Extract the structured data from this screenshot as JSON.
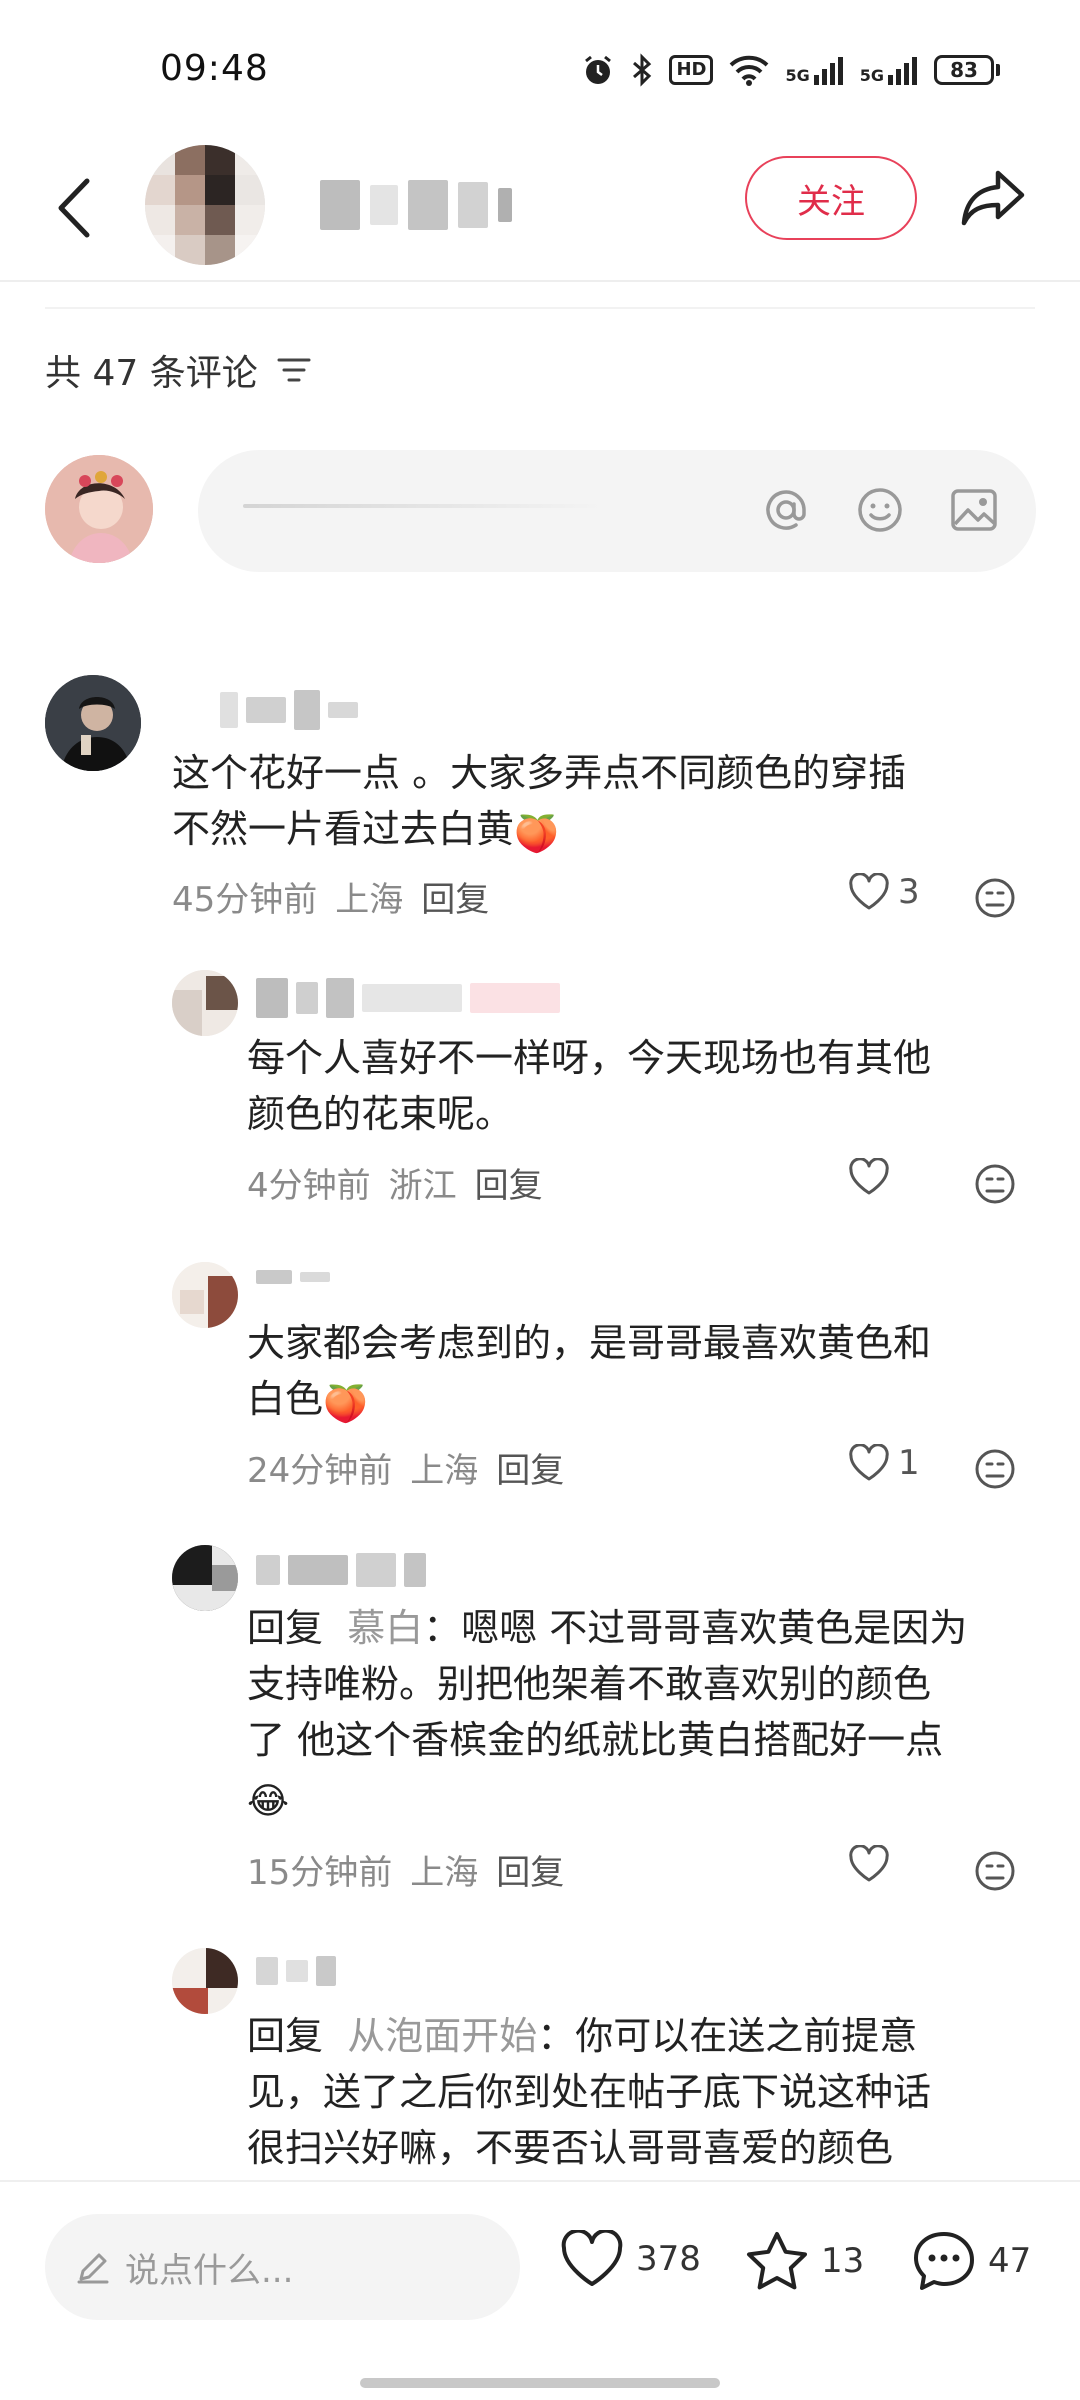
{
  "status_bar": {
    "time": "09:48",
    "hd_label": "HD",
    "net1_label": "5G",
    "net2_label": "5G",
    "battery": "83"
  },
  "header": {
    "follow_label": "关注"
  },
  "comments_summary": {
    "label": "共 47 条评论"
  },
  "comments": [
    {
      "text_line1": "这个花好一点 。大家多弄点不同颜色的穿插",
      "text_line2": "不然一片看过去白黄",
      "time": "45分钟前",
      "location": "上海",
      "reply_label": "回复",
      "likes": "3"
    },
    {
      "text_line1": "每个人喜好不一样呀，今天现场也有其他",
      "text_line2": "颜色的花束呢。",
      "time": "4分钟前",
      "location": "浙江",
      "reply_label": "回复",
      "likes": ""
    },
    {
      "text_line1": "大家都会考虑到的，是哥哥最喜欢黄色和",
      "text_line2": "白色",
      "time": "24分钟前",
      "location": "上海",
      "reply_label": "回复",
      "likes": "1"
    },
    {
      "reply_prefix": "回复",
      "reply_to": "慕白",
      "text_line1": "：嗯嗯 不过哥哥喜欢黄色是因为",
      "text_line2": "支持唯粉。别把他架着不敢喜欢别的颜色",
      "text_line3": "了 他这个香槟金的纸就比黄白搭配好一点",
      "time": "15分钟前",
      "location": "上海",
      "reply_label": "回复",
      "likes": ""
    },
    {
      "reply_prefix": "回复",
      "reply_to": "从泡面开始",
      "text_line1": "：你可以在送之前提意",
      "text_line2": "见，送了之后你到处在帖子底下说这种话",
      "text_line3": "很扫兴好嘛，不要否认哥哥喜爱的颜色"
    }
  ],
  "bottom_bar": {
    "input_placeholder": "说点什么...",
    "likes": "378",
    "favorites": "13",
    "comments": "47"
  },
  "colors": {
    "accent": "#e02d4a",
    "meta_gray": "#8a8a8a"
  }
}
